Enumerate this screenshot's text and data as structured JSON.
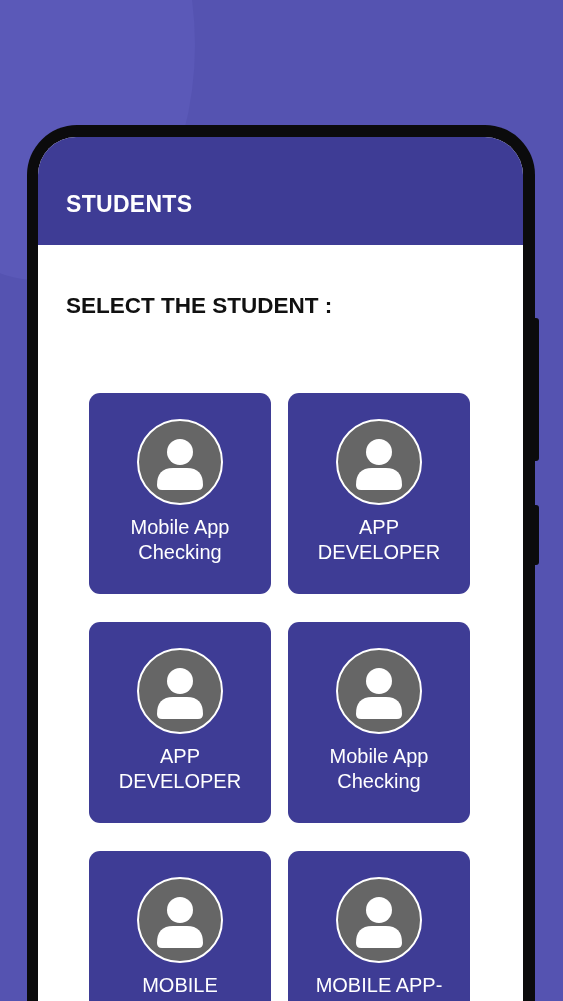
{
  "app_bar": {
    "title": "STUDENTS"
  },
  "prompt": "SELECT THE STUDENT :",
  "students": [
    {
      "name": "Mobile App Checking"
    },
    {
      "name": "APP DEVELOPER"
    },
    {
      "name": "APP DEVELOPER"
    },
    {
      "name": "Mobile App Checking"
    },
    {
      "name": "MOBILE"
    },
    {
      "name": "MOBILE APP-"
    }
  ]
}
